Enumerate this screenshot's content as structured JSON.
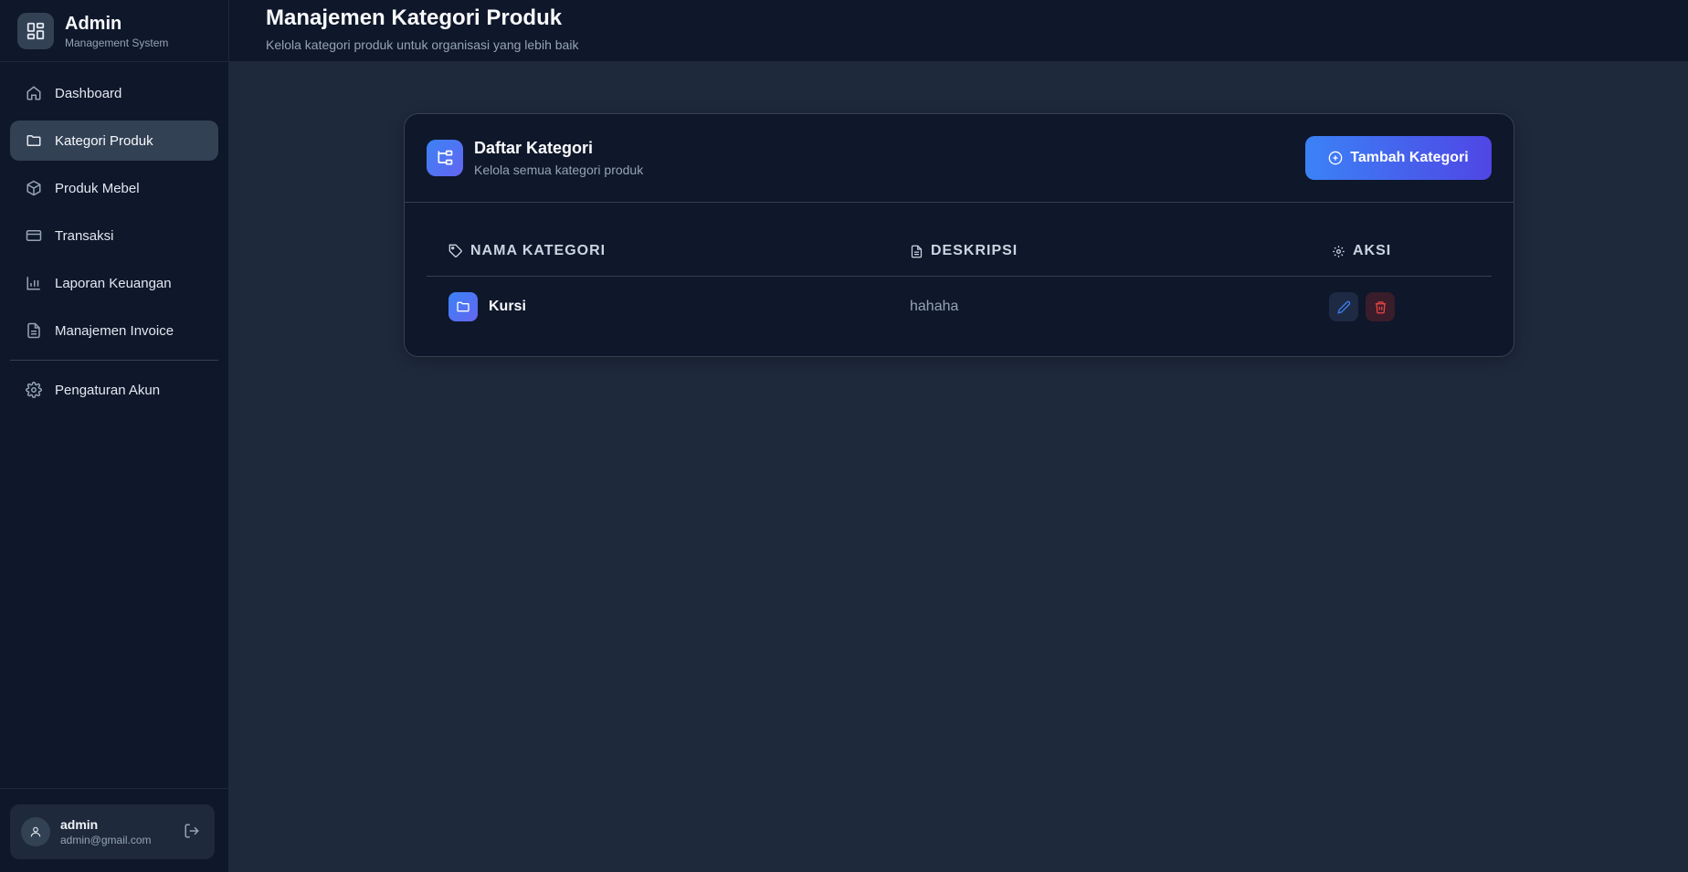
{
  "brand": {
    "title": "Admin",
    "subtitle": "Management System",
    "icon": "dashboard-grid-icon"
  },
  "sidebar": {
    "items": [
      {
        "label": "Dashboard",
        "icon": "home-icon"
      },
      {
        "label": "Kategori Produk",
        "icon": "folder-icon",
        "active": true
      },
      {
        "label": "Produk Mebel",
        "icon": "box-icon"
      },
      {
        "label": "Transaksi",
        "icon": "credit-card-icon"
      },
      {
        "label": "Laporan Keuangan",
        "icon": "bar-chart-icon"
      },
      {
        "label": "Manajemen Invoice",
        "icon": "file-text-icon"
      }
    ],
    "settings": {
      "label": "Pengaturan Akun",
      "icon": "gear-icon"
    }
  },
  "user": {
    "name": "admin",
    "email": "admin@gmail.com"
  },
  "header": {
    "title": "Manajemen Kategori Produk",
    "subtitle": "Kelola kategori produk untuk organisasi yang lebih baik"
  },
  "card": {
    "title": "Daftar Kategori",
    "subtitle": "Kelola semua kategori produk",
    "add_button": "Tambah Kategori"
  },
  "table": {
    "columns": [
      "NAMA KATEGORI",
      "DESKRIPSI",
      "AKSI"
    ],
    "rows": [
      {
        "name": "Kursi",
        "description": "hahaha"
      }
    ]
  },
  "colors": {
    "accent": "#3b82f6",
    "accent2": "#4f46e5",
    "bg": "#1e293b",
    "panel": "#0f172a",
    "danger": "#ef4444"
  }
}
